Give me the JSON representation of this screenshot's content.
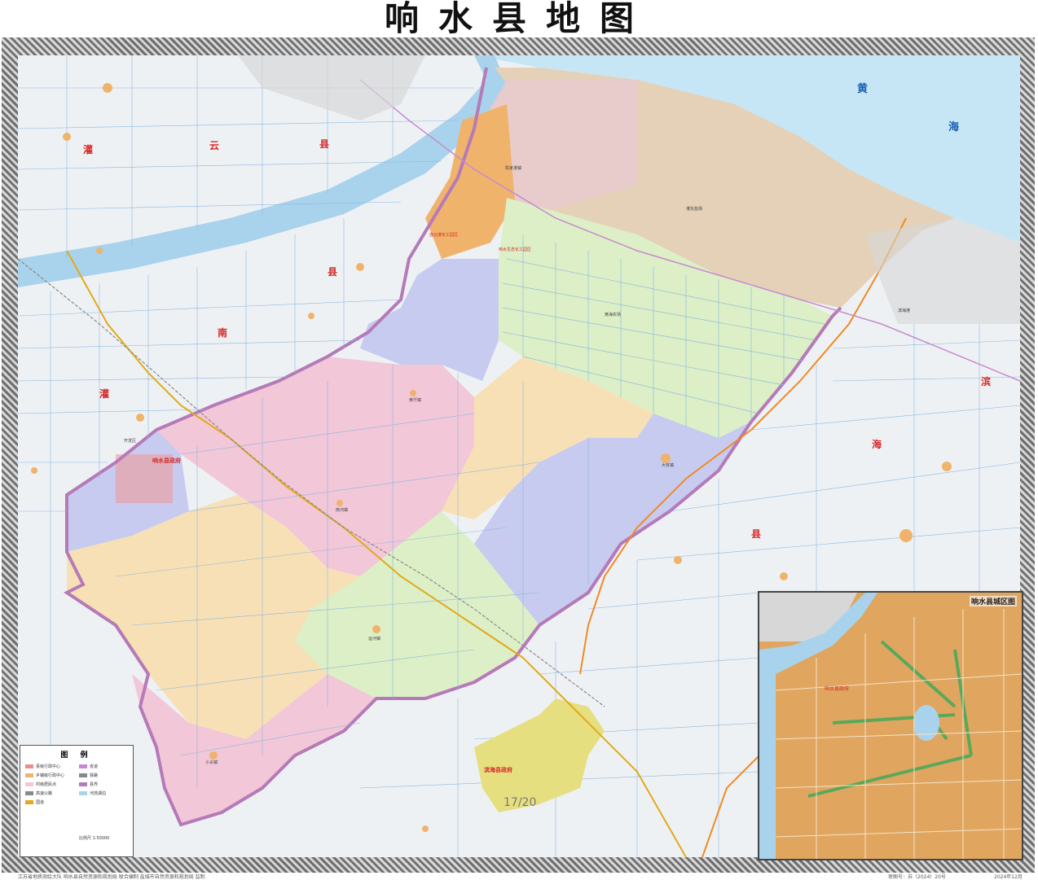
{
  "map": {
    "title": "响水县地图",
    "page_indicator": "17/20",
    "regions": {
      "guanyun_1": "灌",
      "guanyun_2": "云",
      "guanyun_3": "县",
      "guannan_1": "灌",
      "guannan_2": "南",
      "guannan_3": "县",
      "binhai_1": "滨",
      "binhai_2": "海",
      "binhai_3": "县",
      "yellow_sea_1": "黄",
      "yellow_sea_2": "海"
    },
    "places": {
      "xiangshui_county": "响水县政府",
      "binhai_county": "滨海县政府",
      "chenjiagang": "陈家港镇",
      "dayou": "大有镇",
      "yunjiang": "运河镇",
      "nanhe": "南河镇",
      "huangwei": "黄圩镇",
      "xiaojian": "小尖镇",
      "kouwu": "开发区",
      "guannan_industrial": "连云港化工园区",
      "yinhua": "响水生态化工园区",
      "shore_farm": "灌东盐场",
      "field_a": "黄海农场",
      "field_b": "滨海港"
    },
    "colors": {
      "sea": "#c7e6f5",
      "river": "#a9d3ec",
      "boundary": "#b57ab8",
      "pink": "#f2c7d7",
      "yellow": "#f7e0b5",
      "green": "#ddefc6",
      "blue": "#c7cbef",
      "orange": "#f0b36b",
      "binhai": "#e6df80",
      "salt": "#e4d1b8",
      "red_label": "#d42a2a",
      "blue_label": "#1a5fb4"
    }
  },
  "legend": {
    "title": "图 例",
    "items": [
      {
        "label": "县级行政中心",
        "color": "#ee8b8b"
      },
      {
        "label": "乡镇级行政中心",
        "color": "#f0b36b"
      },
      {
        "label": "村级居民点",
        "color": "#f2c7d7"
      },
      {
        "label": "高速公路",
        "color": "#8a8a8a"
      },
      {
        "label": "国道",
        "color": "#e0aa1a"
      },
      {
        "label": "省道",
        "color": "#c78ad0"
      },
      {
        "label": "铁路",
        "color": "#888888"
      },
      {
        "label": "县界",
        "color": "#b57ab8"
      },
      {
        "label": "河流湖泊",
        "color": "#a9d3ec"
      }
    ],
    "scale": "比例尺 1:50000"
  },
  "inset": {
    "title": "响水县城区图",
    "label": "响水县政府"
  },
  "footer": {
    "producer": "江苏省地质测绘大队   响水县自然资源和规划局   联合编制   盐城市自然资源和规划局   监制",
    "review": "审图号：苏（2024）20号",
    "date": "2024年12月"
  }
}
